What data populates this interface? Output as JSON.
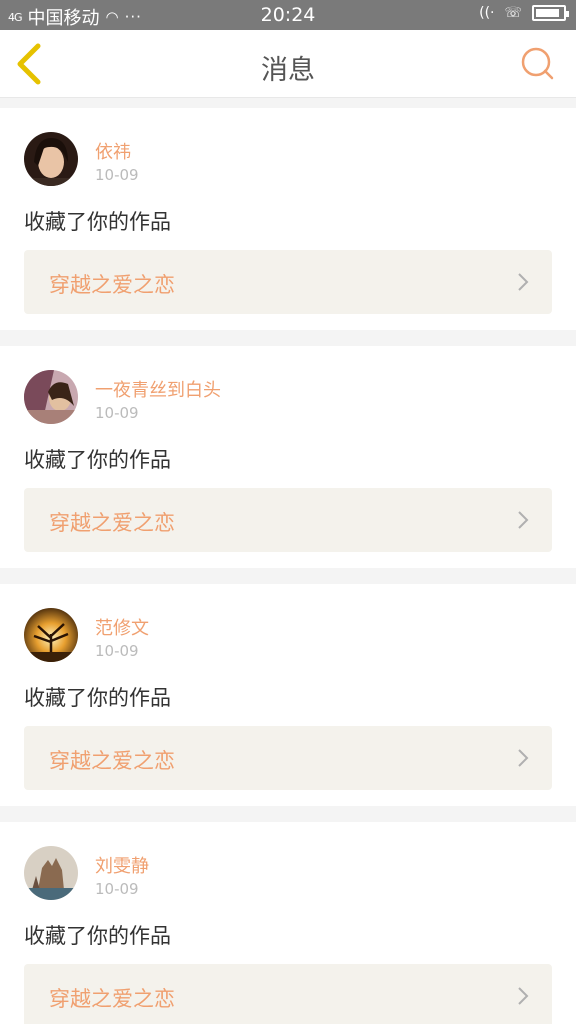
{
  "status_bar": {
    "signal": "4G",
    "carrier": "中国移动",
    "dots": "···",
    "time": "20:24",
    "battery_level": 0.9
  },
  "header": {
    "title": "消息"
  },
  "messages": [
    {
      "username": "依祎",
      "date": "10-09",
      "text": "收藏了你的作品",
      "work_title": "穿越之爱之恋"
    },
    {
      "username": "一夜青丝到白头",
      "date": "10-09",
      "text": "收藏了你的作品",
      "work_title": "穿越之爱之恋"
    },
    {
      "username": "范修文",
      "date": "10-09",
      "text": "收藏了你的作品",
      "work_title": "穿越之爱之恋"
    },
    {
      "username": "刘雯静",
      "date": "10-09",
      "text": "收藏了你的作品",
      "work_title": "穿越之爱之恋"
    }
  ],
  "colors": {
    "accent": "#f0a070",
    "back_arrow": "#e6c200",
    "status_bar": "#7a7a7a",
    "link_bg": "#f4f2ec"
  }
}
